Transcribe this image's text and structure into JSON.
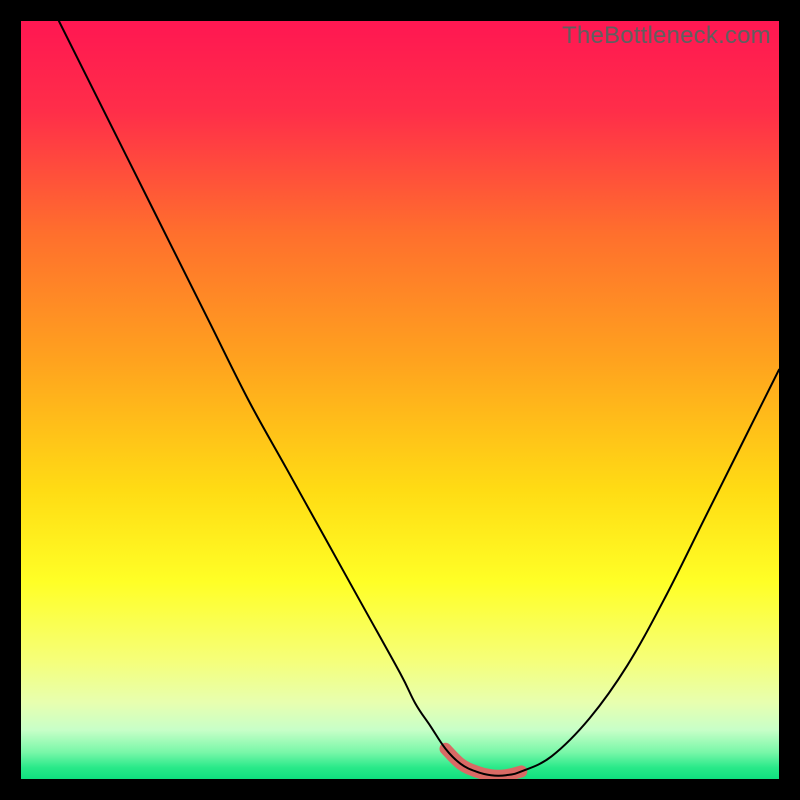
{
  "watermark": {
    "text": "TheBottleneck.com"
  },
  "chart_data": {
    "type": "line",
    "title": "",
    "xlabel": "",
    "ylabel": "",
    "xlim": [
      0,
      100
    ],
    "ylim": [
      0,
      100
    ],
    "grid": false,
    "legend": false,
    "series": [
      {
        "name": "bottleneck-curve",
        "x": [
          5,
          10,
          15,
          20,
          25,
          30,
          35,
          40,
          45,
          50,
          52,
          54,
          56,
          58,
          60,
          62,
          64,
          66,
          70,
          75,
          80,
          85,
          90,
          95,
          100
        ],
        "y": [
          100,
          90,
          80,
          70,
          60,
          50,
          41,
          32,
          23,
          14,
          10,
          7,
          4,
          2,
          1,
          0.5,
          0.5,
          1,
          3,
          8,
          15,
          24,
          34,
          44,
          54
        ]
      },
      {
        "name": "highlight-region",
        "x": [
          56,
          58,
          60,
          62,
          64,
          66
        ],
        "y": [
          4,
          2,
          1,
          0.5,
          0.5,
          1
        ]
      }
    ],
    "gradient_stops": [
      {
        "offset": 0.0,
        "color": "#ff1752"
      },
      {
        "offset": 0.12,
        "color": "#ff2e49"
      },
      {
        "offset": 0.28,
        "color": "#ff6f2d"
      },
      {
        "offset": 0.45,
        "color": "#ffa31e"
      },
      {
        "offset": 0.62,
        "color": "#ffdc14"
      },
      {
        "offset": 0.74,
        "color": "#ffff26"
      },
      {
        "offset": 0.84,
        "color": "#f6ff76"
      },
      {
        "offset": 0.9,
        "color": "#e7ffb0"
      },
      {
        "offset": 0.935,
        "color": "#c8ffc8"
      },
      {
        "offset": 0.965,
        "color": "#78f7a8"
      },
      {
        "offset": 0.985,
        "color": "#29e989"
      },
      {
        "offset": 1.0,
        "color": "#0fdf7f"
      }
    ]
  }
}
